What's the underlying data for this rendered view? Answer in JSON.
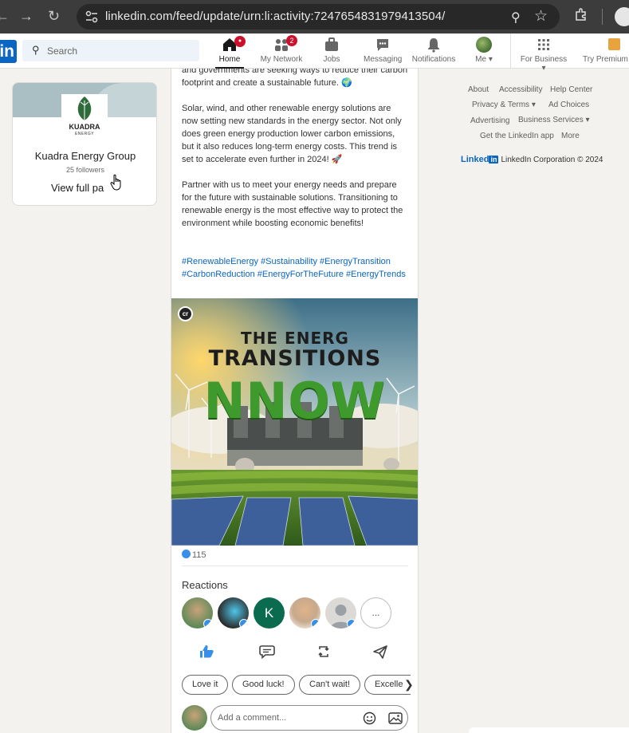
{
  "browser": {
    "url": "linkedin.com/feed/update/urn:li:activity:7247654831979413504/"
  },
  "linkedin_header": {
    "logo": "in",
    "search_placeholder": "Search",
    "nav": [
      {
        "label": "Home",
        "icon": "home-icon",
        "badge": "●",
        "active": true
      },
      {
        "label": "My Network",
        "icon": "network-icon",
        "badge": "2"
      },
      {
        "label": "Jobs",
        "icon": "jobs-icon"
      },
      {
        "label": "Messaging",
        "icon": "messaging-icon"
      },
      {
        "label": "Notifications",
        "icon": "bell-icon"
      },
      {
        "label": "Me",
        "icon": "avatar"
      },
      {
        "label": "For Business",
        "icon": "grid-icon"
      },
      {
        "label": "Try Premium f",
        "icon": "premium-icon"
      }
    ]
  },
  "company_card": {
    "logo_name": "KUADRA",
    "logo_sub": "ENERGY",
    "name": "Kuadra Energy Group",
    "followers": "25 followers",
    "view_link": "View full pa"
  },
  "post": {
    "paragraph0": "and governments are seeking ways to reduce their carbon footprint and create a sustainable future. 🌍",
    "paragraph1": "Solar, wind, and other renewable energy solutions are now setting new standards in the energy sector. Not only does green energy production lower carbon emissions, but it also reduces long-term energy costs. This trend is set to accelerate even further in 2024! 🚀",
    "paragraph2": "Partner with us to meet your energy needs and prepare for the future with sustainable solutions. Transitioning to renewable energy is the most effective way to protect the environment while boosting economic benefits!",
    "hashtags": "#RenewableEnergy #Sustainability #EnergyTransition #CarbonReduction #EnergyForTheFuture #EnergyTrends",
    "image": {
      "badge": "cr",
      "line1": "THE ENERG",
      "line2": "TRANSITIONS",
      "line3": "NNOW"
    },
    "reaction_count": "115",
    "reactions_title": "Reactions",
    "avatar_initial": "K",
    "more_reactors": "...",
    "quick_replies": [
      "Love it",
      "Good luck!",
      "Can't wait!",
      "Excelle"
    ],
    "comment_placeholder": "Add a comment..."
  },
  "footer": {
    "links": [
      "About",
      "Accessibility",
      "Help Center",
      "Privacy & Terms",
      "Ad Choices",
      "Advertising",
      "Business Services",
      "Get the LinkedIn app",
      "More"
    ],
    "brand_word": "Linked",
    "brand_in": "in",
    "copyright": "LinkedIn Corporation © 2024"
  },
  "colors": {
    "accent": "#0a66c2",
    "badge": "#cb112d",
    "like": "#378fe9"
  }
}
